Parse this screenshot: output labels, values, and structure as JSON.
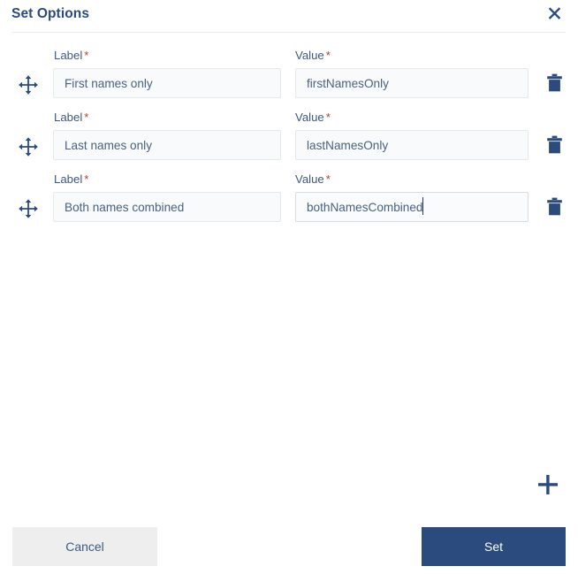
{
  "dialog": {
    "title": "Set Options",
    "close_icon": "close-icon"
  },
  "columns": {
    "label_header": "Label",
    "value_header": "Value",
    "required_marker": "*"
  },
  "rows": [
    {
      "drag_icon": "move-arrows-icon",
      "label_value": "First names only",
      "value_value": "firstNamesOnly",
      "delete_icon": "trash-icon",
      "focused": false
    },
    {
      "drag_icon": "move-arrows-icon",
      "label_value": "Last names only",
      "value_value": "lastNamesOnly",
      "delete_icon": "trash-icon",
      "focused": false
    },
    {
      "drag_icon": "move-arrows-icon",
      "label_value": "Both names combined",
      "value_value": "bothNamesCombined",
      "delete_icon": "trash-icon",
      "focused": true
    }
  ],
  "add_button": {
    "icon": "plus-icon"
  },
  "footer": {
    "cancel_label": "Cancel",
    "set_label": "Set"
  },
  "colors": {
    "navy": "#2b4b7e",
    "title_blue": "#2a4a7f",
    "label_blue": "#41587d",
    "required_red": "#c0392b",
    "input_bg": "#f8fafb",
    "input_border": "#e6e9ec",
    "cancel_bg": "#eeeeee",
    "divider": "#e9eaec"
  }
}
